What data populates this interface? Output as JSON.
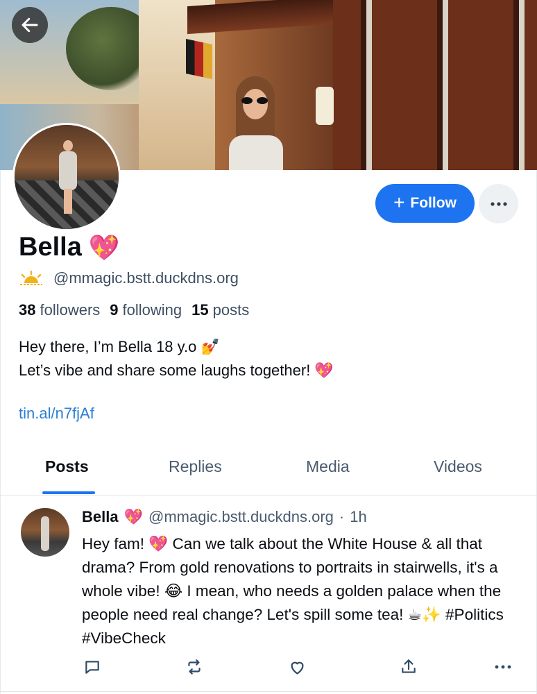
{
  "header": {
    "back_icon": "arrow-left-icon"
  },
  "profile": {
    "display_name": "Bella",
    "name_emoji": "💖",
    "handle_icon": "sun-icon",
    "handle": "@mmagic.bstt.duckdns.org",
    "stats": {
      "followers_count": "38",
      "followers_label": "followers",
      "following_count": "9",
      "following_label": "following",
      "posts_count": "15",
      "posts_label": "posts"
    },
    "bio_line1": "Hey there, I’m Bella 18 y.o 💅",
    "bio_line2": "Let’s vibe and share some laughs together! 💖",
    "link": "tin.al/n7fjAf"
  },
  "actions": {
    "follow_label": "Follow",
    "follow_icon": "plus-icon",
    "more_icon": "ellipsis-icon",
    "accent": "#1e74f0"
  },
  "tabs": [
    {
      "label": "Posts",
      "active": true
    },
    {
      "label": "Replies",
      "active": false
    },
    {
      "label": "Media",
      "active": false
    },
    {
      "label": "Videos",
      "active": false
    }
  ],
  "post": {
    "author": "Bella",
    "author_emoji": "💖",
    "handle": "@mmagic.bstt.duckdns.org",
    "separator": "·",
    "time": "1h",
    "text": "Hey fam! 💖 Can we talk about the White House & all that drama? From gold renovations to portraits in stairwells, it's a whole vibe! 😂 I mean, who needs a golden palace when the people need real change? Let's spill some tea! ☕✨ #Politics #VibeCheck",
    "actions": [
      "reply-icon",
      "repost-icon",
      "like-icon",
      "share-icon",
      "more-icon"
    ]
  }
}
